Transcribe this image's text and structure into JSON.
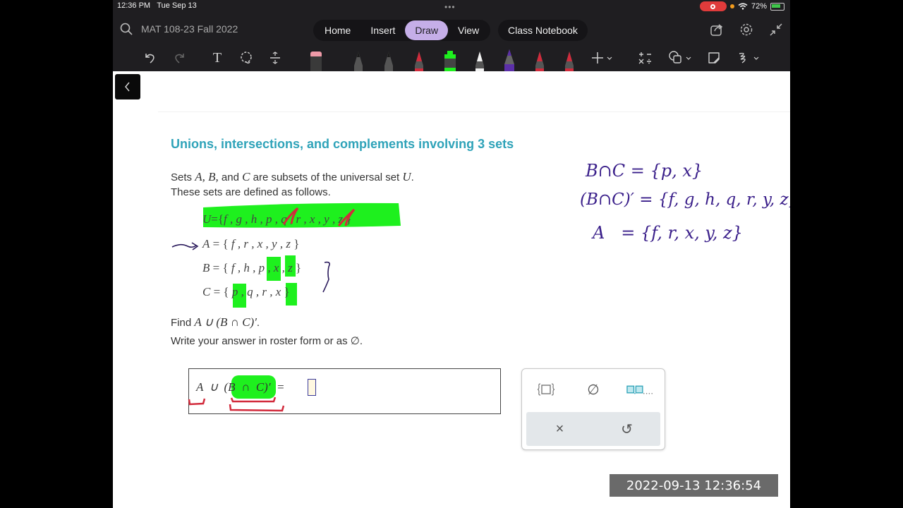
{
  "status_bar": {
    "time": "12:36 PM",
    "date": "Tue Sep 13",
    "more_dots": "•••",
    "battery_percent": "72%"
  },
  "header": {
    "notebook_title": "MAT 108-23 Fall 2022",
    "tabs": [
      {
        "label": "Home",
        "active": false
      },
      {
        "label": "Insert",
        "active": false
      },
      {
        "label": "Draw",
        "active": true
      },
      {
        "label": "View",
        "active": false
      }
    ],
    "class_notebook_label": "Class Notebook",
    "accent_color": "#c5aee8"
  },
  "toolbar": {
    "tools": [
      "undo-icon",
      "redo-icon",
      "text-icon",
      "lasso-icon",
      "insert-space-icon",
      "eraser-icon"
    ],
    "pens": [
      {
        "name": "pen-black-1",
        "color": "#2b2b2b"
      },
      {
        "name": "pen-black-2",
        "color": "#2b2b2b"
      },
      {
        "name": "pen-red-1",
        "color": "#d22b3c"
      },
      {
        "name": "highlighter-green",
        "color": "#1ef01e"
      },
      {
        "name": "pen-white",
        "color": "#f2f2f2"
      },
      {
        "name": "pen-purple",
        "color": "#5b2fa8"
      },
      {
        "name": "pen-red-2",
        "color": "#d22b3c"
      },
      {
        "name": "pen-red-3",
        "color": "#d22b3c"
      }
    ],
    "extra_tools": [
      "add-pen-icon",
      "math-icon",
      "shapes-icon",
      "sticky-note-icon",
      "ink-to-text-icon"
    ]
  },
  "problem": {
    "title": "Unions, intersections, and complements involving 3 sets",
    "intro_line1_pre": "Sets ",
    "intro_line1_sets": "A, B,",
    "intro_line1_and": " and ",
    "intro_line1_c": "C",
    "intro_line1_post": " are subsets of the universal set ",
    "intro_line1_u": "U",
    "intro_line1_end": ".",
    "intro_line2": "These sets are defined as follows.",
    "sets": {
      "U": {
        "label": "U",
        "elements": [
          "f",
          "g",
          "h",
          "p",
          "q",
          "r",
          "x",
          "y",
          "z"
        ]
      },
      "A": {
        "label": "A",
        "elements": [
          "f",
          "r",
          "x",
          "y",
          "z"
        ]
      },
      "B": {
        "label": "B",
        "elements": [
          "f",
          "h",
          "p",
          "x",
          "z"
        ]
      },
      "C": {
        "label": "C",
        "elements": [
          "p",
          "q",
          "r",
          "x"
        ]
      }
    },
    "find_label": "Find ",
    "find_expr": "A ∪ (B ∩ C)′",
    "find_end": ".",
    "instruction": "Write your answer in roster form or as ∅.",
    "answer_expr": "A  ∪  (B  ∩  C)′  =",
    "answer_value": ""
  },
  "keypad": {
    "keys_row1": [
      "set-braces",
      "∅",
      "□,□,..."
    ],
    "keys_row2": [
      "×",
      "↺"
    ]
  },
  "handwritten_notes": {
    "line1": "B∩C = {p, x}",
    "line2": "(B∩C)′ = {f, g, h, q, r, y, z}",
    "line3": "A   = {f, r, x, y, z}"
  },
  "timestamp": "2022-09-13 12:36:54"
}
